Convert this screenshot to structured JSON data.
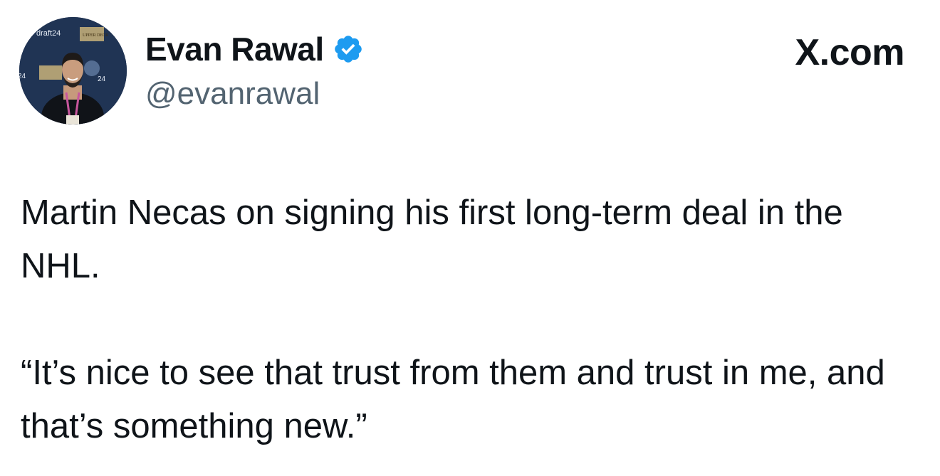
{
  "author": {
    "display_name": "Evan Rawal",
    "handle": "@evanrawal",
    "verified": true,
    "verified_icon": "verified-badge-icon",
    "avatar_backdrop_texts": [
      "draft24",
      "UPPER DECK",
      "24"
    ]
  },
  "brand": {
    "label": "X.com"
  },
  "tweet": {
    "paragraph_1": "Martin Necas on signing his first long-term deal in the NHL.",
    "paragraph_2": "“It’s nice to see that trust from them and trust in me, and that’s something new.”"
  },
  "colors": {
    "text_primary": "#0f1419",
    "text_secondary": "#536471",
    "verified_blue": "#1d9bf0",
    "background": "#ffffff"
  }
}
